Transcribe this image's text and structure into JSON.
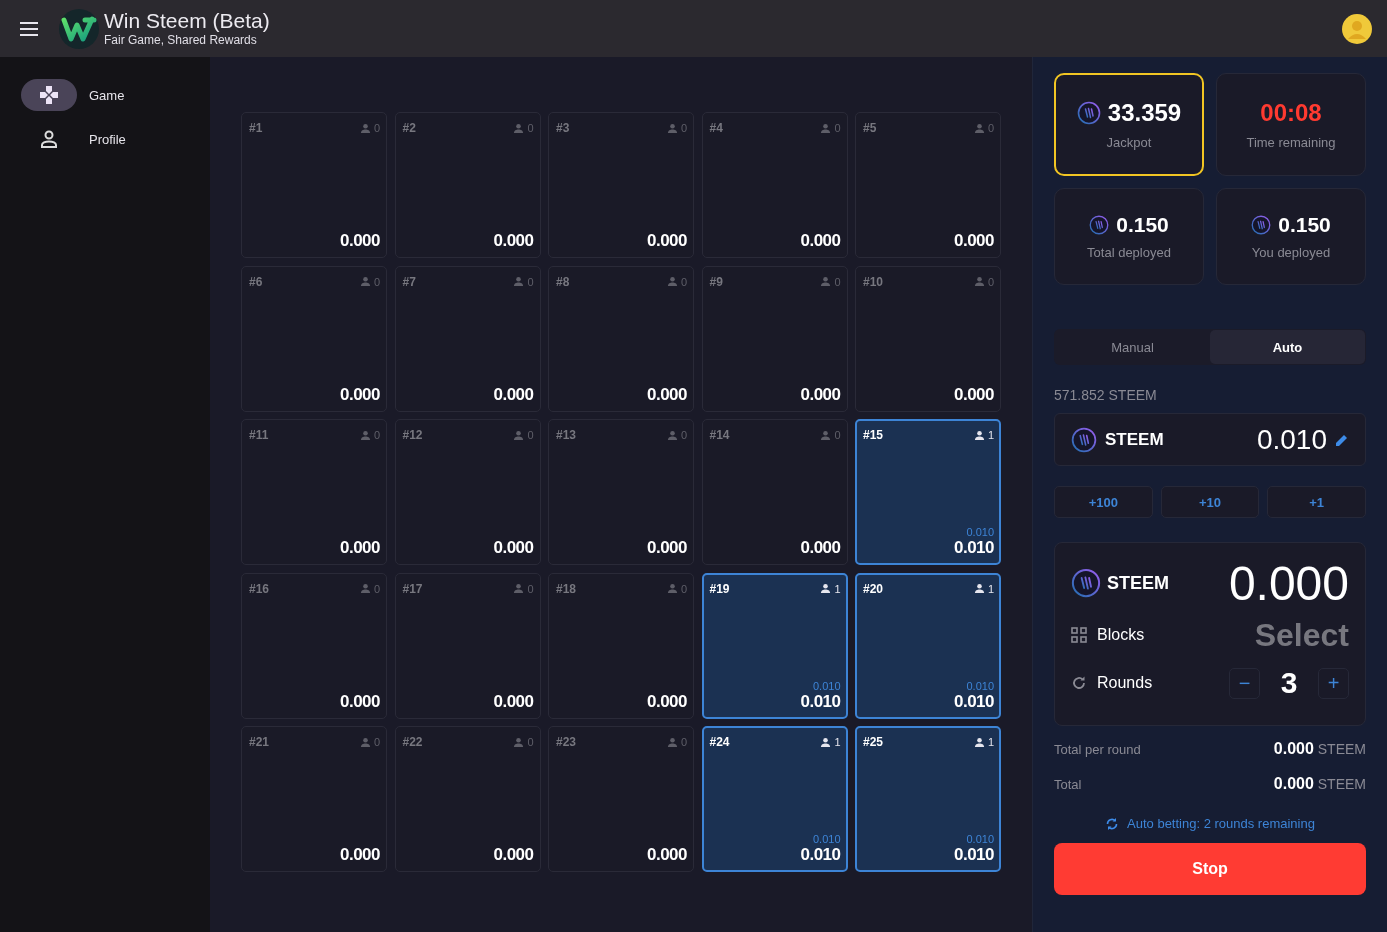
{
  "app": {
    "title": "Win Steem (Beta)",
    "subtitle": "Fair Game, Shared Rewards"
  },
  "nav": [
    {
      "label": "Game",
      "kind": "game",
      "selected": true
    },
    {
      "label": "Profile",
      "kind": "profile",
      "selected": false
    }
  ],
  "blocks": [
    {
      "label": "#1",
      "players": "0",
      "amount": "0.000",
      "selected": false
    },
    {
      "label": "#2",
      "players": "0",
      "amount": "0.000",
      "selected": false
    },
    {
      "label": "#3",
      "players": "0",
      "amount": "0.000",
      "selected": false
    },
    {
      "label": "#4",
      "players": "0",
      "amount": "0.000",
      "selected": false
    },
    {
      "label": "#5",
      "players": "0",
      "amount": "0.000",
      "selected": false
    },
    {
      "label": "#6",
      "players": "0",
      "amount": "0.000",
      "selected": false
    },
    {
      "label": "#7",
      "players": "0",
      "amount": "0.000",
      "selected": false
    },
    {
      "label": "#8",
      "players": "0",
      "amount": "0.000",
      "selected": false
    },
    {
      "label": "#9",
      "players": "0",
      "amount": "0.000",
      "selected": false
    },
    {
      "label": "#10",
      "players": "0",
      "amount": "0.000",
      "selected": false
    },
    {
      "label": "#11",
      "players": "0",
      "amount": "0.000",
      "selected": false
    },
    {
      "label": "#12",
      "players": "0",
      "amount": "0.000",
      "selected": false
    },
    {
      "label": "#13",
      "players": "0",
      "amount": "0.000",
      "selected": false
    },
    {
      "label": "#14",
      "players": "0",
      "amount": "0.000",
      "selected": false
    },
    {
      "label": "#15",
      "players": "1",
      "mine": "0.010",
      "amount": "0.010",
      "selected": true
    },
    {
      "label": "#16",
      "players": "0",
      "amount": "0.000",
      "selected": false
    },
    {
      "label": "#17",
      "players": "0",
      "amount": "0.000",
      "selected": false
    },
    {
      "label": "#18",
      "players": "0",
      "amount": "0.000",
      "selected": false
    },
    {
      "label": "#19",
      "players": "1",
      "mine": "0.010",
      "amount": "0.010",
      "selected": true
    },
    {
      "label": "#20",
      "players": "1",
      "mine": "0.010",
      "amount": "0.010",
      "selected": true
    },
    {
      "label": "#21",
      "players": "0",
      "amount": "0.000",
      "selected": false
    },
    {
      "label": "#22",
      "players": "0",
      "amount": "0.000",
      "selected": false
    },
    {
      "label": "#23",
      "players": "0",
      "amount": "0.000",
      "selected": false
    },
    {
      "label": "#24",
      "players": "1",
      "mine": "0.010",
      "amount": "0.010",
      "selected": true
    },
    {
      "label": "#25",
      "players": "1",
      "mine": "0.010",
      "amount": "0.010",
      "selected": true
    }
  ],
  "stats": [
    {
      "kind": "jackpot",
      "value": "33.359",
      "label": "Jackpot",
      "highlighted": true
    },
    {
      "kind": "timer",
      "value": "00:08",
      "label": "Time remaining",
      "highlighted": false
    },
    {
      "kind": "amount",
      "value": "0.150",
      "label": "Total deployed",
      "highlighted": false
    },
    {
      "kind": "amount",
      "value": "0.150",
      "label": "You deployed",
      "highlighted": false
    }
  ],
  "mode_tabs": [
    {
      "label": "Manual",
      "selected": false
    },
    {
      "label": "Auto",
      "selected": true
    }
  ],
  "balance": "571.852 STEEM",
  "bet": {
    "currency": "STEEM",
    "value": "0.010"
  },
  "increments": [
    "+100",
    "+10",
    "+1"
  ],
  "summary_card": {
    "currency": "STEEM",
    "amount": "0.000",
    "rows": [
      {
        "kind": "select",
        "label": "Blocks",
        "placeholder": "Select"
      },
      {
        "kind": "stepper",
        "label": "Rounds",
        "value": "3",
        "minus": "−",
        "plus": "+"
      }
    ]
  },
  "totals": [
    {
      "label": "Total per round",
      "value": "0.000",
      "unit": "STEEM"
    },
    {
      "label": "Total",
      "value": "0.000",
      "unit": "STEEM"
    }
  ],
  "auto_status": "Auto betting: 2 rounds remaining",
  "stop_button": "Stop"
}
